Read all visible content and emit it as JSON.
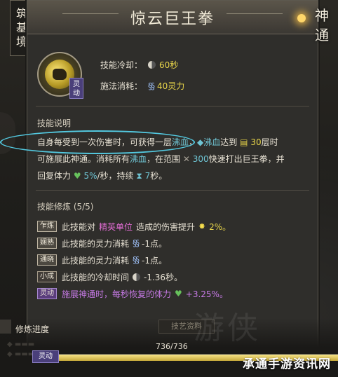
{
  "realm": {
    "lines": [
      "筑",
      "基",
      "境"
    ]
  },
  "skill": {
    "title": "惊云巨王拳",
    "type_badge": "灵动",
    "icon": "fist-icon",
    "cooldown_label": "技能冷却：",
    "cooldown_value": "60秒",
    "cost_label": "施法消耗：",
    "cost_value": "40灵力"
  },
  "brand": {
    "lines": [
      "神",
      "通"
    ]
  },
  "description": {
    "heading": "技能说明",
    "line1_a": "自身每受到一次伤害时，可获得一层",
    "line1_hl1": "沸血",
    "line1_b": "，",
    "line1_hl2": "沸血",
    "line1_c": "达到",
    "line1_num": "30",
    "line1_d": "层时",
    "line2_a": "可施展此神通。消耗所有",
    "line2_hl": "沸血",
    "line2_b": "，在范围",
    "line2_num": "300",
    "line2_c": "快速打出巨王拳，并",
    "line3_a": "回复体力",
    "line3_num1": "5%",
    "line3_b": "/秒，持续",
    "line3_num2": "7",
    "line3_c": "秒。"
  },
  "cultivation": {
    "heading": "技能修炼 (5/5)",
    "items": [
      {
        "badge": "乍炼",
        "a": "此技能对",
        "hl": "精英单位",
        "b": "造成的伤害提升",
        "val": "2%。"
      },
      {
        "badge": "娴熟",
        "a": "此技能的灵力消耗",
        "val": "-1点。"
      },
      {
        "badge": "通晓",
        "a": "此技能的灵力消耗",
        "val": "-1点。"
      },
      {
        "badge": "小成",
        "a": "此技能的冷却时间",
        "val": "-1.36秒。"
      },
      {
        "badge": "灵动",
        "a": "施展神通时，每秒恢复的体力",
        "val": "+3.25%。"
      }
    ]
  },
  "progress": {
    "heading": "修炼进度",
    "count": "736/736",
    "fraction": 1.0,
    "badge": "灵动",
    "side_tab": "技艺资料"
  },
  "watermark": "承通手游资讯网",
  "colors": {
    "accent_gold": "#e8d54a",
    "highlight_cyan": "#6fc5d4",
    "elite_pink": "#e46dd6",
    "badge_purple": "#5a3d7c"
  }
}
